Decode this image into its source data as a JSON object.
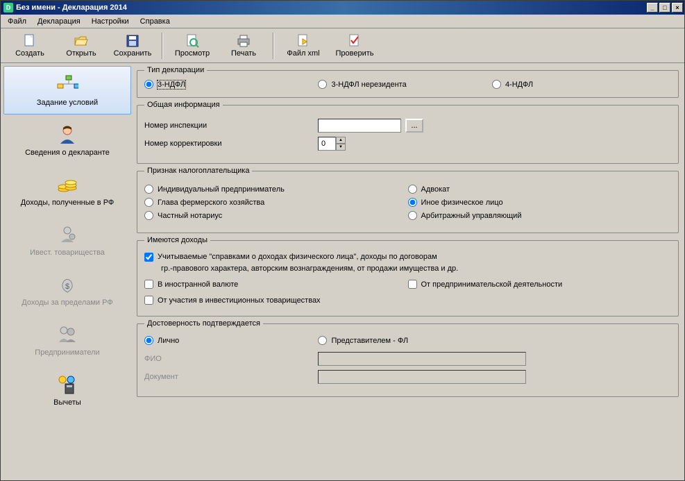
{
  "window": {
    "title": "Без имени - Декларация 2014"
  },
  "menu": {
    "file": "Файл",
    "decl": "Декларация",
    "settings": "Настройки",
    "help": "Справка"
  },
  "toolbar": {
    "create": "Создать",
    "open": "Открыть",
    "save": "Сохранить",
    "preview": "Просмотр",
    "print": "Печать",
    "xml": "Файл xml",
    "check": "Проверить"
  },
  "sidebar": {
    "items": [
      {
        "label": "Задание условий"
      },
      {
        "label": "Сведения о декларанте"
      },
      {
        "label": "Доходы, полученные в РФ"
      },
      {
        "label": "Ивест. товарищества"
      },
      {
        "label": "Доходы за пределами РФ"
      },
      {
        "label": "Предприниматели"
      },
      {
        "label": "Вычеты"
      }
    ]
  },
  "panels": {
    "type": {
      "legend": "Тип декларации",
      "opt1": "3-НДФЛ",
      "opt2": "3-НДФЛ нерезидента",
      "opt3": "4-НДФЛ"
    },
    "general": {
      "legend": "Общая информация",
      "inspection": "Номер инспекции",
      "inspection_value": "",
      "correction": "Номер корректировки",
      "correction_value": "0"
    },
    "taxpayer": {
      "legend": "Признак налогоплательщика",
      "opt_ip": "Индивидуальный предприниматель",
      "opt_lawyer": "Адвокат",
      "opt_farm": "Глава фермерского хозяйства",
      "opt_other": "Иное физическое лицо",
      "opt_notary": "Частный нотариус",
      "opt_arbitr": "Арбитражный управляющий"
    },
    "income": {
      "legend": "Имеются доходы",
      "chk1": "Учитываемые \"справками о доходах физического лица\", доходы по договорам",
      "chk1b": "гр.-правового характера, авторским вознаграждениям, от продажи имущества и др.",
      "chk2": "В иностранной валюте",
      "chk3": "От предпринимательской деятельности",
      "chk4": "От участия в инвестиционных товариществах"
    },
    "trust": {
      "legend": "Достоверность подтверждается",
      "opt_self": "Лично",
      "opt_rep": "Представителем - ФЛ",
      "fio": "ФИО",
      "fio_value": "",
      "doc": "Документ",
      "doc_value": ""
    }
  }
}
